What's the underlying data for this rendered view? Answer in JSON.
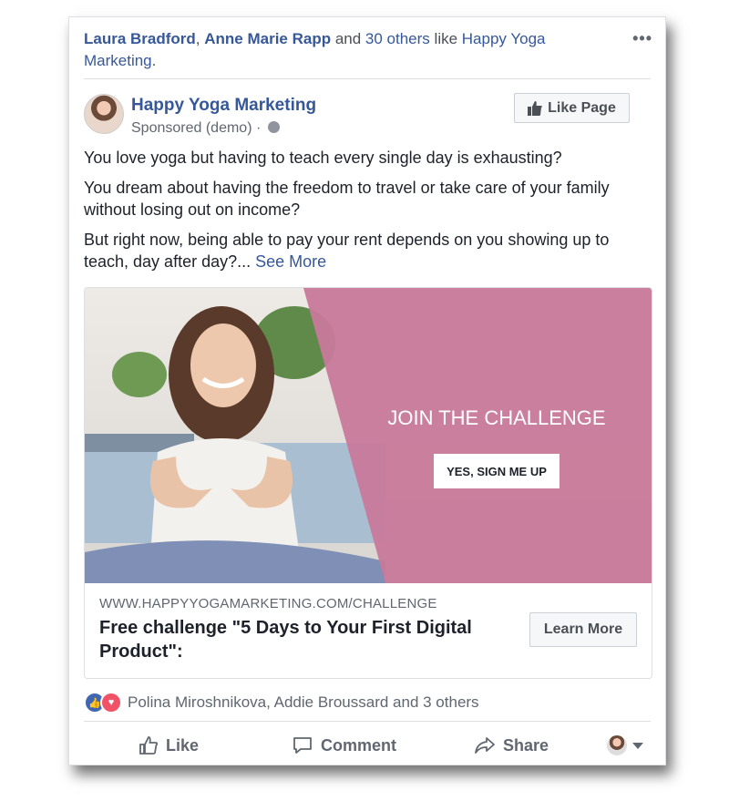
{
  "social_context": {
    "friend1": "Laura Bradford",
    "sep": ", ",
    "friend2": "Anne Marie Rapp",
    "connector": " and ",
    "others": "30 others",
    "like_text": " like ",
    "page": "Happy Yoga Marketing",
    "end": "."
  },
  "menu_icon": "more-dots-icon",
  "post": {
    "page_name": "Happy Yoga Marketing",
    "sponsored": "Sponsored (demo) ·",
    "like_page_label": "Like Page",
    "paragraphs": [
      "You love yoga but having to teach every single day is exhausting?",
      "You dream about having the freedom to travel or take care of your family without losing out on income?",
      "But right now, being able to pay your rent depends on you showing up to teach, day after day?..."
    ],
    "see_more": "See More"
  },
  "ad": {
    "image_heading": "JOIN THE CHALLENGE",
    "image_button": "YES, SIGN ME UP",
    "url": "WWW.HAPPYYOGAMARKETING.COM/CHALLENGE",
    "headline": "Free challenge \"5 Days to Your First Digital Product\":",
    "cta": "Learn More"
  },
  "reactions": {
    "text": "Polina Miroshnikova, Addie Broussard and 3 others"
  },
  "actions": {
    "like": "Like",
    "comment": "Comment",
    "share": "Share"
  },
  "colors": {
    "link_blue": "#365899",
    "ad_pink": "#c8799a",
    "like_blue": "#4267b2",
    "love_red": "#f25268"
  }
}
